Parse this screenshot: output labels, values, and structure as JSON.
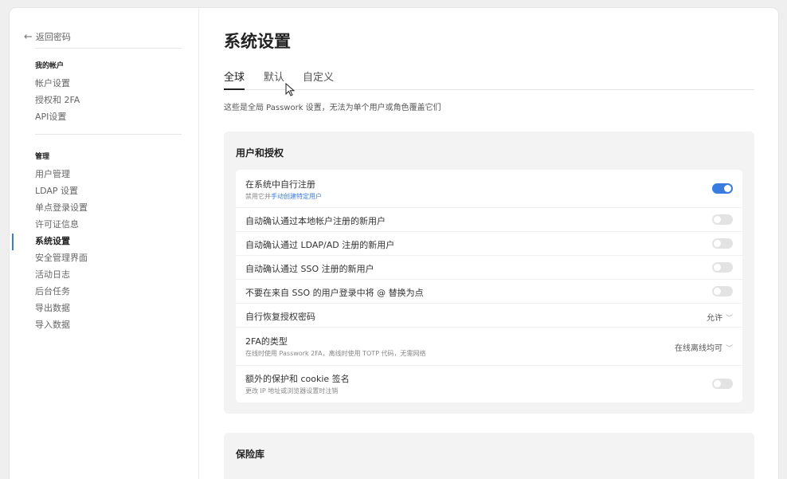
{
  "sidebar": {
    "back_label": "返回密码",
    "account_heading": "我的帐户",
    "account_items": [
      "帐户设置",
      "授权和 2FA",
      "API设置"
    ],
    "admin_heading": "管理",
    "admin_items": [
      "用户管理",
      "LDAP 设置",
      "单点登录设置",
      "许可证信息",
      "系统设置",
      "安全管理界面",
      "活动日志",
      "后台任务",
      "导出数据",
      "导入数据"
    ],
    "active_item": "系统设置"
  },
  "main": {
    "title": "系统设置",
    "tabs": [
      "全球",
      "默认",
      "自定义"
    ],
    "active_tab": "全球",
    "subtitle": "这些是全局 Passwork 设置，无法为单个用户或角色覆盖它们"
  },
  "section_users": {
    "title": "用户和授权",
    "rows": [
      {
        "label": "在系统中自行注册",
        "sub_prefix": "禁用它并",
        "sub_link": "手动创建特定用户",
        "control": "toggle",
        "on": true
      },
      {
        "label": "自动确认通过本地帐户注册的新用户",
        "control": "toggle",
        "on": false
      },
      {
        "label": "自动确认通过 LDAP/AD 注册的新用户",
        "control": "toggle",
        "on": false
      },
      {
        "label": "自动确认通过 SSO 注册的新用户",
        "control": "toggle",
        "on": false
      },
      {
        "label": "不要在来自 SSO 的用户登录中将 @ 替换为点",
        "control": "toggle",
        "on": false
      },
      {
        "label": "自行恢复授权密码",
        "control": "dropdown",
        "value": "允许"
      },
      {
        "label": "2FA的类型",
        "sub": "在线时使用 Passwork 2FA，离线时使用 TOTP 代码，无需网络",
        "control": "dropdown",
        "value": "在线离线均可"
      },
      {
        "label": "额外的保护和 cookie 签名",
        "sub": "更改 IP 地址或浏览器设置时注销",
        "control": "toggle",
        "on": false
      }
    ]
  },
  "section_vault": {
    "title": "保险库"
  },
  "icons": {
    "back": "arrow-left-icon",
    "dropdown": "chevron-down-icon",
    "cursor": "mouse-pointer-icon"
  },
  "colors": {
    "accent": "#3a7be0",
    "toggle_off": "#e3e3e3",
    "section_bg": "#f3f3f4"
  }
}
